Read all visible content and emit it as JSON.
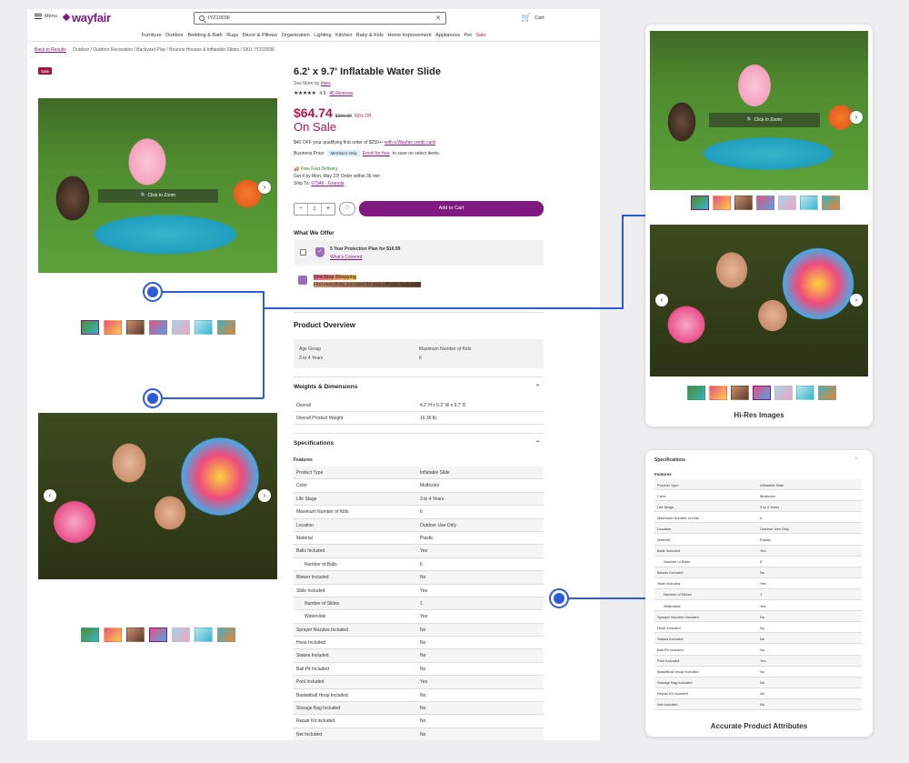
{
  "header": {
    "menu_label": "Menu",
    "logo": "wayfair",
    "search_value": "IYZ10036",
    "cart_label": "Cart"
  },
  "categories": [
    "Furniture",
    "Outdoor",
    "Bedding & Bath",
    "Rugs",
    "Décor & Pillows",
    "Organization",
    "Lighting",
    "Kitchen",
    "Baby & Kids",
    "Home Improvement",
    "Appliances",
    "Pet",
    "Sale"
  ],
  "breadcrumb": {
    "back": "Back to Results",
    "path": "Outdoor / Outdoor Recreation / Backyard Play / Bounce Houses & Inflatable Slides / SKU: IYZ10036"
  },
  "product": {
    "badge": "Sale",
    "title": "6.2' x 9.7' Inflatable Water Slide",
    "see_more_prefix": "See More by",
    "brand": "Intex",
    "stars": "★★★★★",
    "rating": "4.9",
    "reviews": "45 Reviews",
    "price": "$64.74",
    "old_price": "$159.99",
    "discount": "60% Off",
    "on_sale": "On Sale",
    "promo_text": "$40 OFF your qualifying first order of $250+¹",
    "promo_link": "with a Wayfair credit card",
    "biz_label": "Business Price:",
    "members_only": "Members Only",
    "enroll_link": "Enroll for free",
    "enroll_suffix": "to save on select items.",
    "free_delivery": "Free Fast Delivery",
    "get_it": "Get it by Mon, May 23! Order within 36 min",
    "ship_to_label": "Ship To:",
    "ship_to": "67346 - Granola",
    "qty_minus": "−",
    "qty_value": "1",
    "qty_plus": "+",
    "add_to_cart": "Add to Cart",
    "zoom_label": "Click to Zoom"
  },
  "offer": {
    "heading": "What We Offer",
    "plan": "5 Year Protection Plan for $16.99",
    "covered": "What's Covered",
    "onestop_title": "One-Stop Shopping",
    "onestop_text": "Find everything you need for your ultimate back yard!"
  },
  "overview": {
    "heading": "Product Overview",
    "age_label": "Age Group",
    "age_value": "3 to 4 Years",
    "kids_label": "Maximum Number of Kids",
    "kids_value": "6"
  },
  "weights": {
    "heading": "Weights & Dimensions",
    "rows": [
      {
        "k": "Overall",
        "v": "4.2' H x 6.2' W x 9.7' D"
      },
      {
        "k": "Overall Product Weight",
        "v": "16.36 lb."
      }
    ]
  },
  "specs": {
    "heading": "Specifications",
    "features": "Features",
    "rows": [
      {
        "k": "Product Type",
        "v": "Inflatable Slide",
        "ind": false
      },
      {
        "k": "Color",
        "v": "Multicolor",
        "ind": false
      },
      {
        "k": "Life Stage",
        "v": "3 to 4 Years",
        "ind": false
      },
      {
        "k": "Maximum Number of Kids",
        "v": "6",
        "ind": false
      },
      {
        "k": "Location",
        "v": "Outdoor Use Only",
        "ind": false
      },
      {
        "k": "Material",
        "v": "Plastic",
        "ind": false
      },
      {
        "k": "Balls Included",
        "v": "Yes",
        "ind": false
      },
      {
        "k": "Number of Balls",
        "v": "6",
        "ind": true
      },
      {
        "k": "Blower Included",
        "v": "No",
        "ind": false
      },
      {
        "k": "Slide Included",
        "v": "Yes",
        "ind": false
      },
      {
        "k": "Number of Slides",
        "v": "1",
        "ind": true
      },
      {
        "k": "Waterslide",
        "v": "Yes",
        "ind": true
      },
      {
        "k": "Sprayer Nozzles Included",
        "v": "No",
        "ind": false
      },
      {
        "k": "Hose Included",
        "v": "No",
        "ind": false
      },
      {
        "k": "Stakes Included",
        "v": "No",
        "ind": false
      },
      {
        "k": "Ball Pit Included",
        "v": "No",
        "ind": false
      },
      {
        "k": "Pool Included",
        "v": "Yes",
        "ind": false
      },
      {
        "k": "Basketball Hoop Included",
        "v": "No",
        "ind": false
      },
      {
        "k": "Storage Bag Included",
        "v": "No",
        "ind": false
      },
      {
        "k": "Repair Kit Included",
        "v": "No",
        "ind": false
      },
      {
        "k": "Net Included",
        "v": "No",
        "ind": false
      }
    ]
  },
  "cards": {
    "hires_title": "Hi-Res Images",
    "attrs_title": "Accurate Product Attributes"
  },
  "icons": {
    "prev": "‹",
    "next": "›",
    "chevron_up": "⌃",
    "heart": "♡",
    "close": "✕",
    "cart": "🛒",
    "truck": "🚚"
  },
  "colors": {
    "brand": "#7f187f",
    "sale": "#b5174b",
    "connector": "#2d5bd8"
  }
}
